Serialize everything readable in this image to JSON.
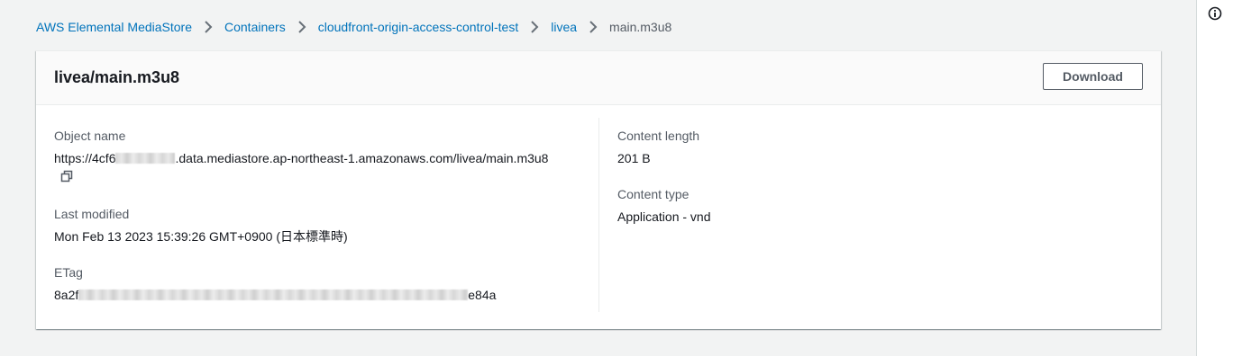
{
  "breadcrumb": {
    "items": [
      {
        "label": "AWS Elemental MediaStore"
      },
      {
        "label": "Containers"
      },
      {
        "label": "cloudfront-origin-access-control-test"
      },
      {
        "label": "livea"
      }
    ],
    "current": "main.m3u8"
  },
  "panel": {
    "title": "livea/main.m3u8",
    "download_label": "Download"
  },
  "details": {
    "object_name": {
      "label": "Object name",
      "value_prefix": "https://4cf6",
      "value_suffix": ".data.mediastore.ap-northeast-1.amazonaws.com/livea/main.m3u8"
    },
    "last_modified": {
      "label": "Last modified",
      "value": "Mon Feb 13 2023 15:39:26 GMT+0900 (日本標準時)"
    },
    "etag": {
      "label": "ETag",
      "value_prefix": "8a2f",
      "value_suffix": "e84a"
    },
    "content_length": {
      "label": "Content length",
      "value": "201 B"
    },
    "content_type": {
      "label": "Content type",
      "value": "Application - vnd"
    }
  },
  "icons": {
    "copy": "copy-icon",
    "info": "info-icon",
    "separator": "chevron-right-icon"
  },
  "colors": {
    "link": "#0073bb",
    "background": "#f2f3f3",
    "text": "#16191f",
    "muted": "#545b64"
  }
}
